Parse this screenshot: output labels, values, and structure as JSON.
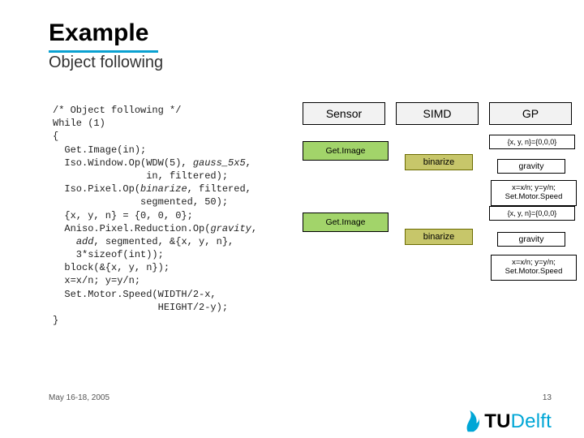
{
  "title": "Example",
  "subtitle": "Object following",
  "code_lines": [
    "/* Object following */",
    "While (1)",
    "{",
    "  Get.Image(in);",
    "  Iso.Window.Op(WDW(5), gauss_5x5,",
    "                in, filtered);",
    "  Iso.Pixel.Op(binarize, filtered,",
    "               segmented, 50);",
    "  {x, y, n} = {0, 0, 0};",
    "  Aniso.Pixel.Reduction.Op(gravity,",
    "    add, segmented, &{x, y, n},",
    "    3*sizeof(int));",
    "  block(&{x, y, n});",
    "  x=x/n; y=y/n;",
    "  Set.Motor.Speed(WIDTH/2-x,",
    "                  HEIGHT/2-y);",
    "}"
  ],
  "columns": {
    "sensor": "Sensor",
    "simd": "SIMD",
    "gp": "GP"
  },
  "nodes": {
    "getimage": "Get.Image",
    "binarize": "binarize",
    "init": "{x, y, n}={0,0,0}",
    "gravity": "gravity",
    "math_line1": "x=x/n; y=y/n;",
    "math_line2": "Set.Motor.Speed"
  },
  "footer": {
    "date": "May 16-18, 2005",
    "page": "13"
  },
  "logo": {
    "tu": "TU",
    "delft": "Delft"
  }
}
